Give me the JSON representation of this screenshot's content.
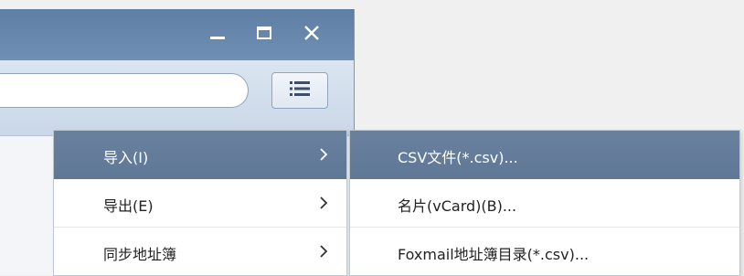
{
  "window": {
    "controls": {
      "minimize_icon": "minimize-icon",
      "maximize_icon": "maximize-icon",
      "close_icon": "close-icon"
    },
    "search": {
      "value": "",
      "placeholder": ""
    },
    "menu_button_icon": "list-icon"
  },
  "context_menu": {
    "items": [
      {
        "label": "导入(I)",
        "has_submenu": true,
        "highlighted": true
      },
      {
        "label": "导出(E)",
        "has_submenu": true,
        "highlighted": false
      },
      {
        "label": "同步地址簿",
        "has_submenu": true,
        "highlighted": false
      }
    ]
  },
  "submenu": {
    "items": [
      {
        "label": "CSV文件(*.csv)...",
        "highlighted": true
      },
      {
        "label": "名片(vCard)(B)...",
        "highlighted": false
      },
      {
        "label": "Foxmail地址簿目录(*.csv)...",
        "highlighted": false
      }
    ]
  },
  "colors": {
    "titlebar": "#5e7ea4",
    "highlight": "#637c9a",
    "menu_bg": "#ffffff"
  }
}
